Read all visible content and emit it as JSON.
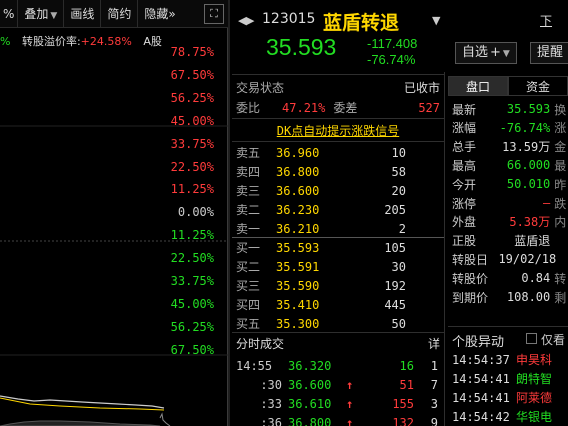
{
  "toolbar": {
    "first_cut": "%",
    "overlay": "叠加",
    "draw": "画线",
    "brief": "简约",
    "hide": "隐藏",
    "more": "»",
    "fullscreen": "⛶"
  },
  "chart": {
    "info_prefix": "%",
    "premium_label": "转股溢价率:",
    "premium_value": "+24.58%",
    "stock_type": "A股",
    "labels": [
      "78.75%",
      "67.50%",
      "56.25%",
      "45.00%",
      "33.75%",
      "22.50%",
      "11.25%",
      "0.00%",
      "11.25%",
      "22.50%",
      "33.75%",
      "45.00%",
      "56.25%",
      "67.50%"
    ]
  },
  "quote": {
    "code": "123015",
    "name": "蓝盾转退",
    "price": "35.593",
    "change": "-117.408",
    "change_pct": "-76.74%",
    "watch_label": "自选",
    "add_label": "+",
    "remind_label": "提醒",
    "next_label": "下"
  },
  "trade": {
    "status_label": "交易状态",
    "status_value": "已收市",
    "weibi_label": "委比",
    "weibi_value": "47.21%",
    "weicha_label": "委差",
    "weicha_value": "527",
    "signal": "DK点自动提示涨跌信号"
  },
  "asks": [
    {
      "label": "卖五",
      "price": "36.960",
      "vol": "10"
    },
    {
      "label": "卖四",
      "price": "36.800",
      "vol": "58"
    },
    {
      "label": "卖三",
      "price": "36.600",
      "vol": "20"
    },
    {
      "label": "卖二",
      "price": "36.230",
      "vol": "205"
    },
    {
      "label": "卖一",
      "price": "36.210",
      "vol": "2"
    }
  ],
  "bids": [
    {
      "label": "买一",
      "price": "35.593",
      "vol": "105"
    },
    {
      "label": "买二",
      "price": "35.591",
      "vol": "30"
    },
    {
      "label": "买三",
      "price": "35.590",
      "vol": "192"
    },
    {
      "label": "买四",
      "price": "35.410",
      "vol": "445"
    },
    {
      "label": "买五",
      "price": "35.300",
      "vol": "50"
    }
  ],
  "ticks": {
    "title": "分时成交",
    "detail": "详",
    "rows": [
      {
        "time": "14:55",
        "price": "36.320",
        "arrow": "",
        "vol": "16",
        "num": "1"
      },
      {
        "time": ":30",
        "price": "36.600",
        "arrow": "↑",
        "vol": "51",
        "num": "7"
      },
      {
        "time": ":33",
        "price": "36.610",
        "arrow": "↑",
        "vol": "155",
        "num": "3"
      },
      {
        "time": ":36",
        "price": "36.800",
        "arrow": "↑",
        "vol": "132",
        "num": "9"
      }
    ]
  },
  "side": {
    "tab_pankou": "盘口",
    "tab_zijin": "资金",
    "stats": [
      {
        "k": "最新",
        "v": "35.593",
        "c": "green",
        "t": "换"
      },
      {
        "k": "涨幅",
        "v": "-76.74%",
        "c": "green",
        "t": "涨"
      },
      {
        "k": "总手",
        "v": "13.59万",
        "c": "white",
        "t": "金"
      },
      {
        "k": "最高",
        "v": "66.000",
        "c": "green",
        "t": "最"
      },
      {
        "k": "今开",
        "v": "50.010",
        "c": "green",
        "t": "昨"
      },
      {
        "k": "涨停",
        "v": "—",
        "c": "red",
        "t": "跌"
      },
      {
        "k": "外盘",
        "v": "5.38万",
        "c": "red",
        "t": "内"
      },
      {
        "k": "正股",
        "v": "蓝盾退",
        "c": "white",
        "t": ""
      },
      {
        "k": "转股日",
        "v": "19/02/18",
        "c": "white",
        "t": ""
      },
      {
        "k": "转股价",
        "v": "0.84",
        "c": "white",
        "t": "转"
      },
      {
        "k": "到期价",
        "v": "108.00",
        "c": "white",
        "t": "剩"
      }
    ],
    "anomaly_title": "个股异动",
    "anomaly_only": "仅看",
    "anomalies": [
      {
        "time": "14:54:37",
        "text": "申昊科",
        "color": "#ff3b3b"
      },
      {
        "time": "14:54:41",
        "text": "朗特智",
        "color": "#22dd22"
      },
      {
        "time": "14:54:41",
        "text": "阿莱德",
        "color": "#ff3b3b"
      },
      {
        "time": "14:54:42",
        "text": "华银电",
        "color": "#22dd22"
      }
    ]
  }
}
